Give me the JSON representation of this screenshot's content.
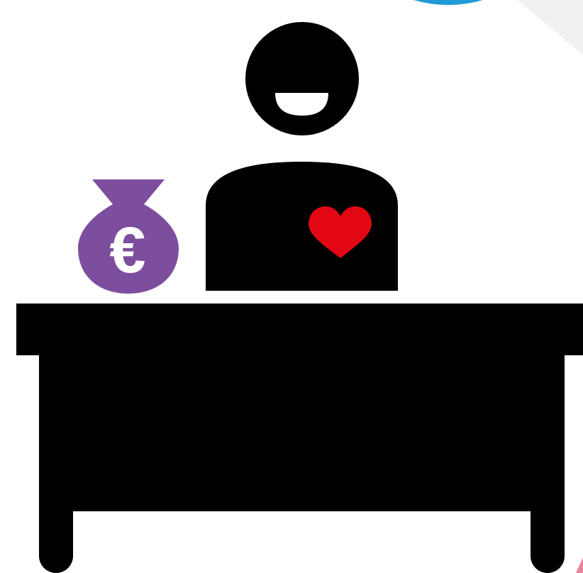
{
  "illustration": {
    "money_bag": {
      "symbol": "€"
    }
  },
  "colors": {
    "background": "#ffffff",
    "figure": "#000000",
    "heart": "#e30613",
    "money_bag": "#7d4e9d",
    "money_bag_symbol": "#ffffff",
    "corner_circle_blue": "#1e9ad6",
    "corner_triangle_grey": "#f1f1f1",
    "corner_shape_pink": "#e9829a"
  },
  "icons": [
    "person-icon",
    "heart-icon",
    "money-bag-icon",
    "desk-icon"
  ]
}
